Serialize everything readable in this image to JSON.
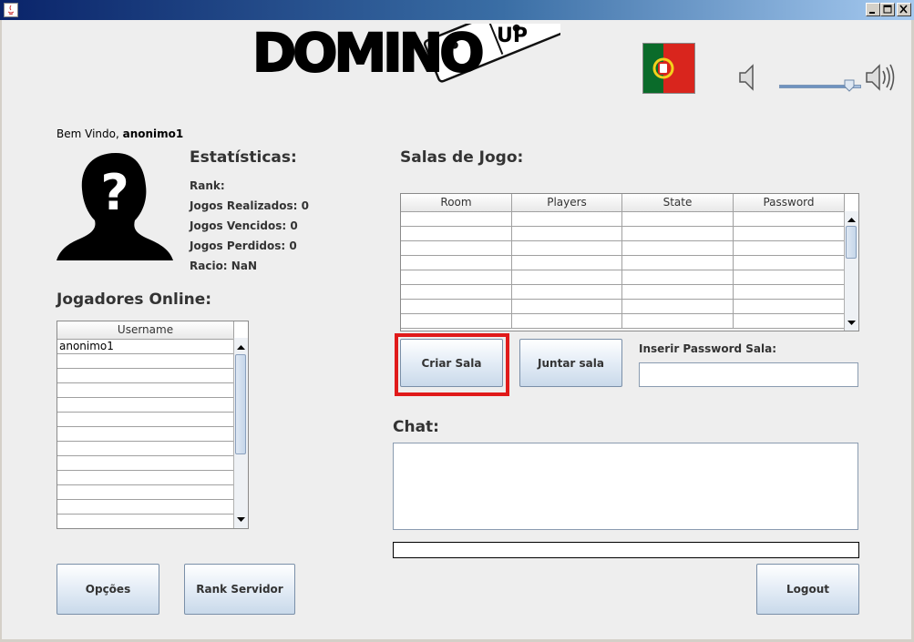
{
  "window": {
    "title": ""
  },
  "header": {
    "logo_text": "DOMINO",
    "logo_suffix": "UP",
    "flag_icon": "portugal-flag",
    "volume_low_icon": "speaker-low-icon",
    "volume_high_icon": "speaker-high-icon",
    "volume_level": 0.85
  },
  "welcome": {
    "prefix": "Bem Vindo,",
    "username": "anonimo1"
  },
  "stats": {
    "title": "Estatísticas:",
    "rank_label": "Rank:",
    "rank_value": "",
    "jogos_realizados_label": "Jogos Realizados:",
    "jogos_realizados_value": "0",
    "jogos_vencidos_label": "Jogos Vencidos:",
    "jogos_vencidos_value": "0",
    "jogos_perdidos_label": "Jogos Perdidos:",
    "jogos_perdidos_value": "0",
    "racio_label": "Racio:",
    "racio_value": "NaN"
  },
  "online": {
    "title": "Jogadores Online:",
    "column": "Username",
    "users": [
      "anonimo1",
      "",
      "",
      "",
      "",
      "",
      "",
      "",
      "",
      "",
      "",
      ""
    ]
  },
  "rooms": {
    "title": "Salas de Jogo:",
    "columns": [
      "Room",
      "Players",
      "State",
      "Password"
    ],
    "rows": 8
  },
  "actions": {
    "criar_sala": "Criar Sala",
    "juntar_sala": "Juntar sala",
    "password_label": "Inserir Password Sala:",
    "password_value": ""
  },
  "chat": {
    "title": "Chat:",
    "messages": "",
    "input_value": ""
  },
  "footer": {
    "opcoes": "Opções",
    "rank_servidor": "Rank Servidor",
    "logout": "Logout"
  },
  "colors": {
    "highlight": "#e01a1a",
    "title_bar": "#0a246a"
  }
}
